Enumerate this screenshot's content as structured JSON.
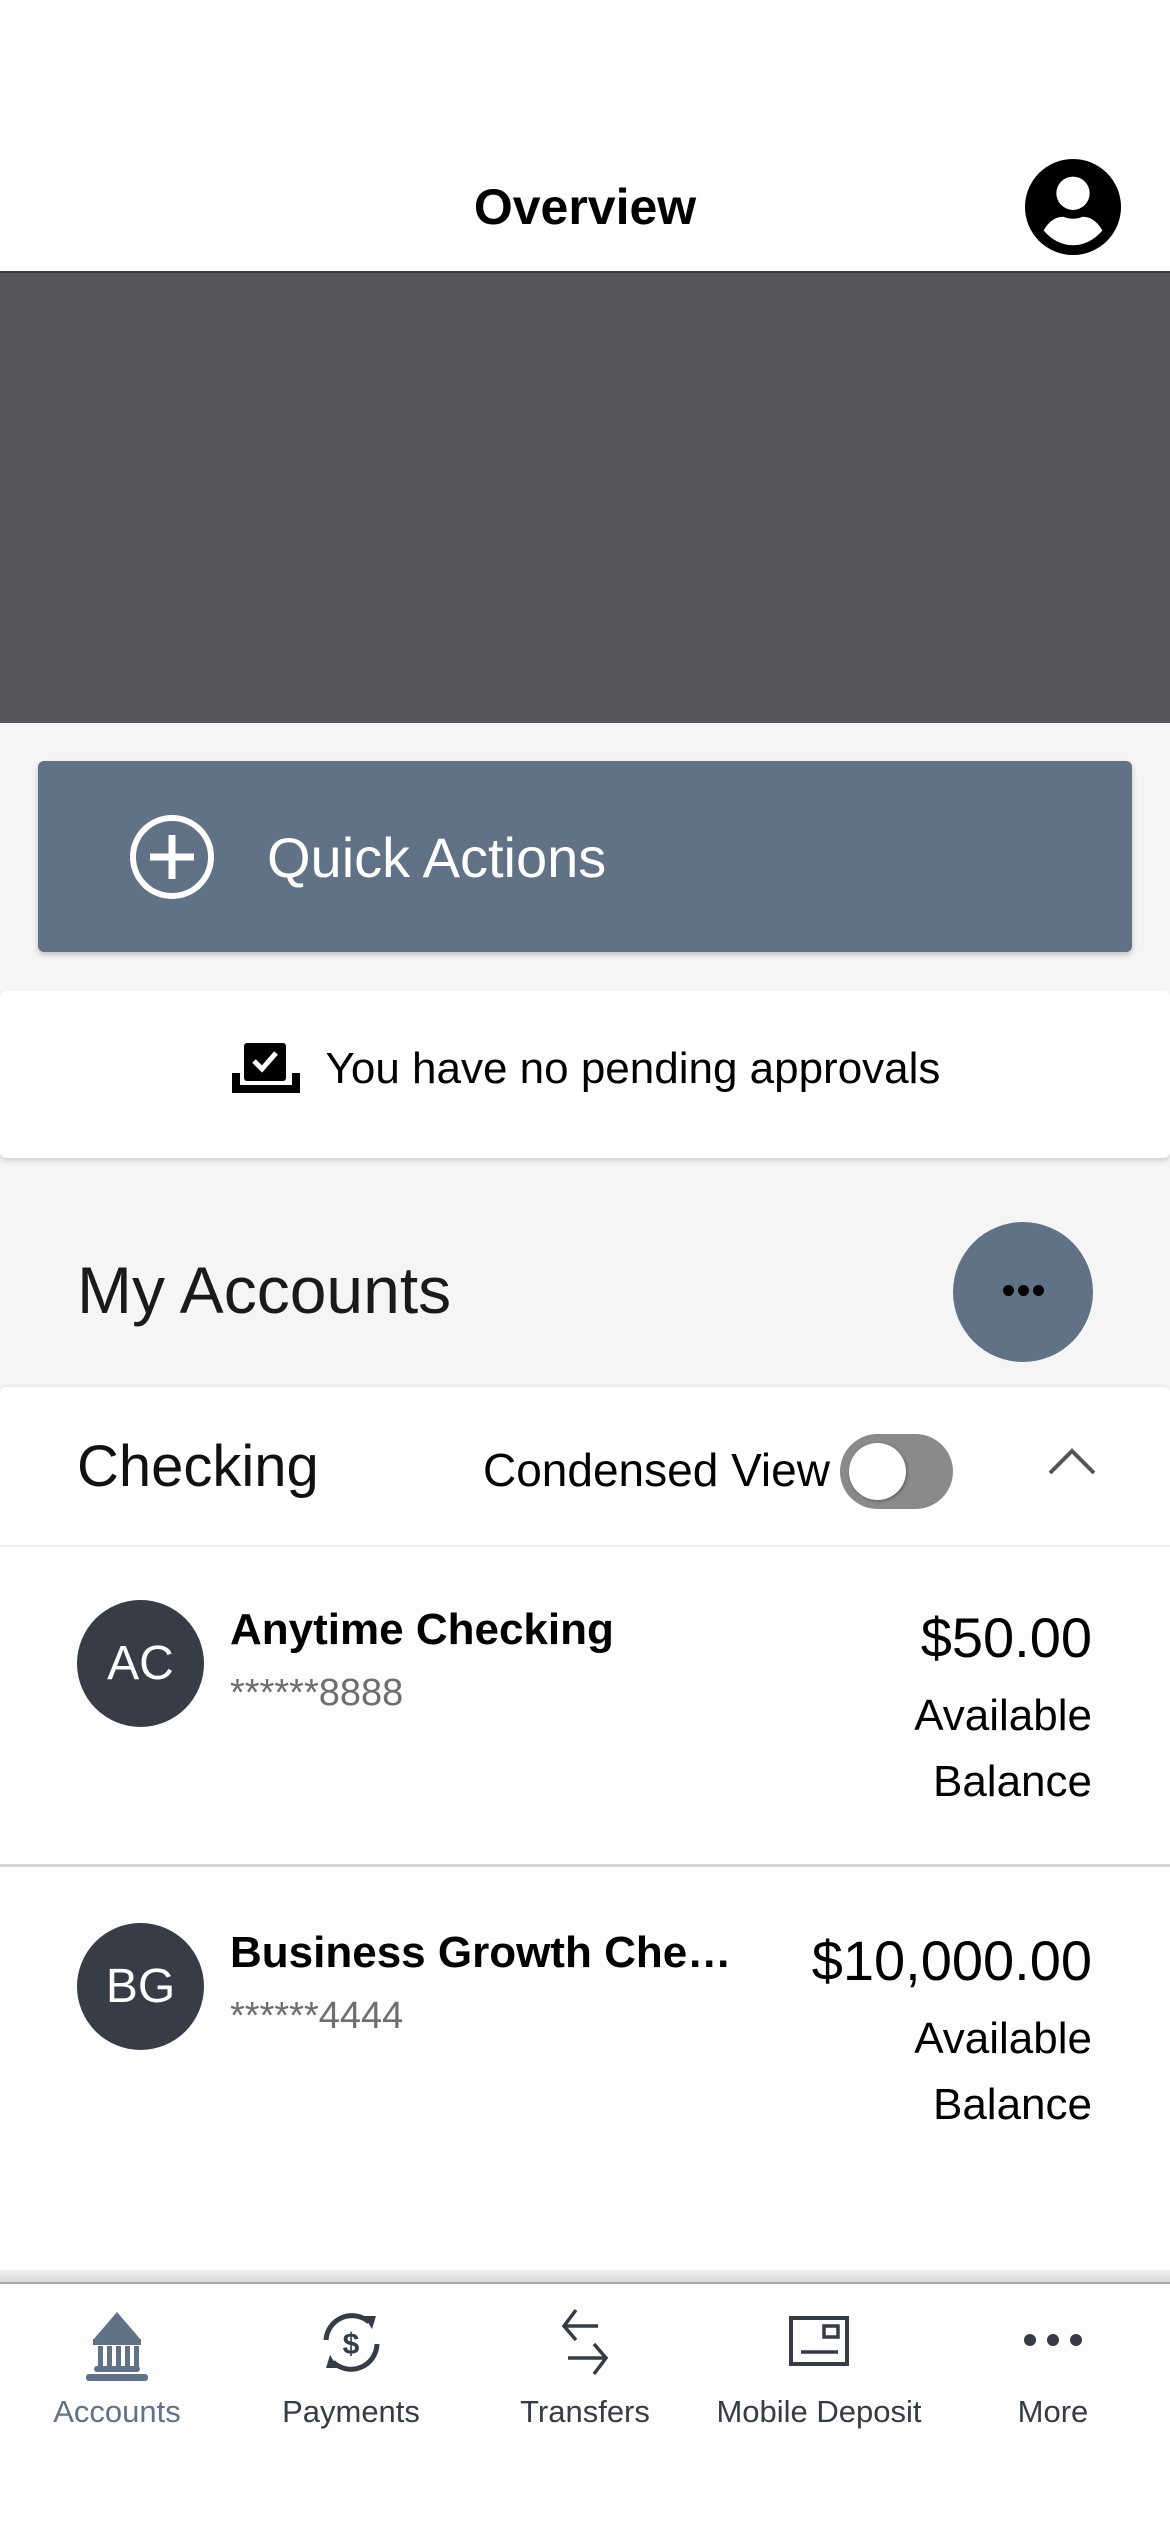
{
  "header": {
    "title": "Overview",
    "profile_icon": "user-circle-icon"
  },
  "quick_actions": {
    "label": "Quick Actions",
    "icon": "plus-circle-icon"
  },
  "approvals": {
    "icon": "approval-check-tray-icon",
    "text": "You have no pending approvals"
  },
  "my_accounts": {
    "title": "My Accounts",
    "more_icon": "more-horizontal-icon"
  },
  "checking": {
    "title": "Checking",
    "condensed_view_label": "Condensed View",
    "condensed_view_on": false,
    "expanded": true,
    "accounts": [
      {
        "initials": "AC",
        "name": "Anytime Checking",
        "number": "******8888",
        "amount": "$50.00",
        "balance_label": "Available Balance"
      },
      {
        "initials": "BG",
        "name": "Business Growth Checki...",
        "number": "******4444",
        "amount": "$10,000.00",
        "balance_label": "Available Balance"
      }
    ]
  },
  "bottom_nav": {
    "items": [
      {
        "label": "Accounts",
        "icon": "bank-icon",
        "active": true
      },
      {
        "label": "Payments",
        "icon": "dollar-cycle-icon",
        "active": false
      },
      {
        "label": "Transfers",
        "icon": "transfer-arrows-icon",
        "active": false
      },
      {
        "label": "Mobile Deposit",
        "icon": "check-deposit-icon",
        "active": false
      },
      {
        "label": "More",
        "icon": "more-horizontal-icon",
        "active": false
      }
    ]
  },
  "colors": {
    "accent": "#627286",
    "banner": "#55565b",
    "avatar_bg": "#373c47",
    "nav_inactive": "#363b46",
    "toggle_off": "#8a8a8a",
    "page_bg": "#f5f5f5"
  }
}
